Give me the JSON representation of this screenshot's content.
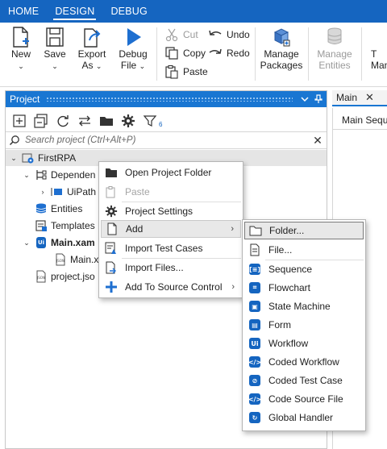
{
  "topbar": {
    "tabs": [
      "HOME",
      "DESIGN",
      "DEBUG"
    ],
    "active": "DESIGN"
  },
  "ribbon": {
    "new": {
      "label": "New",
      "chevron": "⌄"
    },
    "save": {
      "label": "Save",
      "chevron": "⌄"
    },
    "export": {
      "label1": "Export",
      "label2": "As",
      "chevron": "⌄"
    },
    "debug": {
      "label1": "Debug",
      "label2": "File",
      "chevron": "⌄"
    },
    "cut": "Cut",
    "copy": "Copy",
    "paste": "Paste",
    "undo": "Undo",
    "redo": "Redo",
    "manage_packages": {
      "line1": "Manage",
      "line2": "Packages"
    },
    "manage_entities": {
      "line1": "Manage",
      "line2": "Entities"
    },
    "partial": {
      "line1": "T",
      "line2": "Man"
    }
  },
  "project_panel": {
    "title": "Project",
    "filter_count": "6",
    "search_placeholder": "Search project (Ctrl+Alt+P)",
    "tree": {
      "root": "FirstRPA",
      "dependencies": "Dependen",
      "uipath": "UiPath",
      "entities": "Entities",
      "templates": "Templates",
      "main_xaml": "Main.xam",
      "main_x": "Main.x",
      "project_json": "project.jso"
    }
  },
  "main_tab": {
    "label": "Main",
    "sequence_label": "Main Seque"
  },
  "context_menu": {
    "items": [
      {
        "label": "Open Project Folder",
        "icon": "folder-open-icon",
        "disabled": false
      },
      {
        "label": "Paste",
        "icon": "paste-icon",
        "disabled": true
      },
      {
        "label": "Project Settings",
        "icon": "gear-icon",
        "disabled": false
      },
      {
        "label": "Add",
        "icon": "add-file-icon",
        "disabled": false,
        "submenu": true
      },
      {
        "label": "Import Test Cases",
        "icon": "import-test-icon",
        "disabled": false
      },
      {
        "label": "Import Files...",
        "icon": "import-files-icon",
        "disabled": false
      },
      {
        "label": "Add To Source Control",
        "icon": "plus-icon",
        "disabled": false,
        "submenu": true
      }
    ]
  },
  "add_submenu": {
    "items": [
      {
        "label": "Folder...",
        "icon": "folder-icon"
      },
      {
        "label": "File...",
        "icon": "file-icon"
      },
      {
        "label": "Sequence",
        "icon": "sequence-icon"
      },
      {
        "label": "Flowchart",
        "icon": "flowchart-icon"
      },
      {
        "label": "State Machine",
        "icon": "state-machine-icon"
      },
      {
        "label": "Form",
        "icon": "form-icon"
      },
      {
        "label": "Workflow",
        "icon": "workflow-icon"
      },
      {
        "label": "Coded Workflow",
        "icon": "coded-workflow-icon"
      },
      {
        "label": "Coded Test Case",
        "icon": "coded-test-case-icon"
      },
      {
        "label": "Code Source File",
        "icon": "code-source-file-icon"
      },
      {
        "label": "Global Handler",
        "icon": "global-handler-icon"
      }
    ]
  },
  "colors": {
    "brand_blue": "#1565c0",
    "panel_blue": "#1976d2",
    "icon_blue": "#1e6fd0"
  }
}
